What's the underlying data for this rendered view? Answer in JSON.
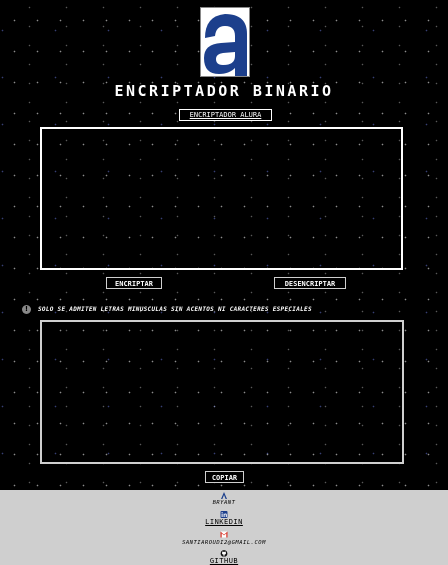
{
  "header": {
    "logo_letter": "a",
    "title": "ENCRIPTADOR BINARIO",
    "subtitle_link": "ENCRIPTADOR ALURA"
  },
  "input": {
    "value": "",
    "placeholder": ""
  },
  "actions": {
    "encrypt_label": "ENCRIPTAR",
    "decrypt_label": "DESENCRIPTAR",
    "copy_label": "COPIAR"
  },
  "notice": {
    "icon": "info-icon",
    "text": "SOLO SE ADMITEN LETRAS MINUSCULAS SIN ACENTOS NI CARACTERES ESPECIALES"
  },
  "output": {
    "value": ""
  },
  "footer": {
    "author_icon": "alura-logo-icon",
    "author": "BRYANT",
    "linkedin_icon": "linkedin-icon",
    "linkedin_label": "LINKEDIN",
    "email_icon": "gmail-icon",
    "email": "SANTIAROUDI2@GMAIL.COM",
    "github_icon": "github-icon",
    "github_label": "GITHUB"
  },
  "colors": {
    "background": "#000000",
    "logo_blue": "#1c3f8c",
    "footer_bg": "#cfcfcf",
    "text": "#ffffff"
  }
}
